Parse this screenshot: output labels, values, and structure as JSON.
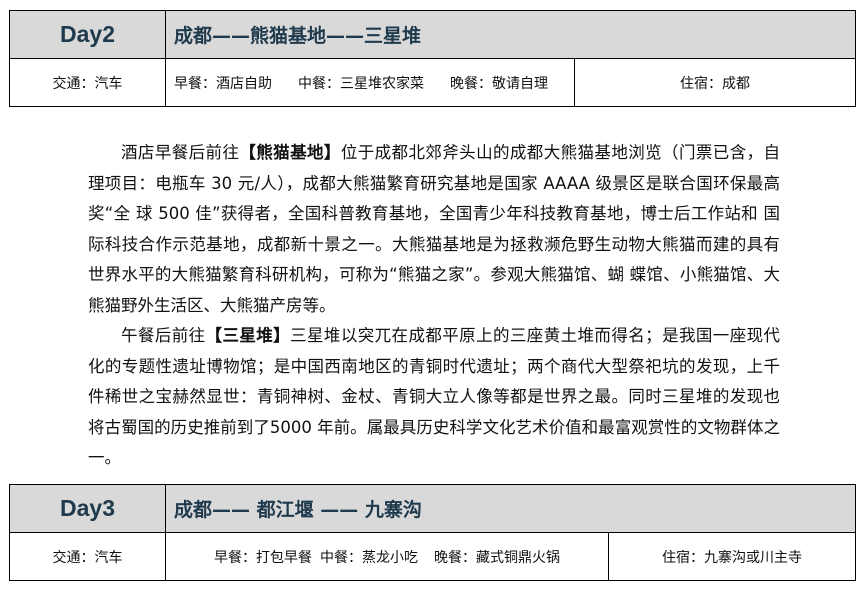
{
  "day2": {
    "day_label": "Day2",
    "route": "成都——熊猫基地——三星堆",
    "transport": "交通：汽车",
    "breakfast": "早餐：酒店自助",
    "lunch": "中餐：三星堆农家菜",
    "dinner": "晚餐：敬请自理",
    "lodging": "住宿：成都"
  },
  "paragraphs": [
    {
      "pre": "酒店早餐后前往",
      "bold": "【熊猫基地】",
      "post": "位于成都北郊斧头山的成都大熊猫基地浏览（门票已含，自理项目：电瓶车 30 元/人），成都大熊猫繁育研究基地是国家 AAAA 级景区是联合国环保最高奖“全 球 500 佳”获得者，全国科普教育基地，全国青少年科技教育基地，博士后工作站和 国际科技合作示范基地，成都新十景之一。大熊猫基地是为拯救濒危野生动物大熊猫而建的具有世界水平的大熊猫繁育科研机构，可称为“熊猫之家”。参观大熊猫馆、蝴 蝶馆、小熊猫馆、大熊猫野外生活区、大熊猫产房等。"
    },
    {
      "pre": "午餐后前往",
      "bold": "【三星堆】",
      "post": "三星堆以突兀在成都平原上的三座黄土堆而得名；是我国一座现代化的专题性遗址博物馆；是中国西南地区的青铜时代遗址；两个商代大型祭祀坑的发现，上千件稀世之宝赫然显世：青铜神树、金杖、青铜大立人像等都是世界之最。同时三星堆的发现也将古蜀国的历史推前到了5000 年前。属最具历史科学文化艺术价值和最富观赏性的文物群体之一。"
    }
  ],
  "day3": {
    "day_label": "Day3",
    "route": "成都—— 都江堰 —— 九寨沟",
    "transport": "交通：汽车",
    "breakfast": "早餐：打包早餐",
    "lunch": "中餐：蒸龙小吃",
    "dinner": "晚餐：藏式铜鼎火锅",
    "lodging": "住宿：九寨沟或川主寺"
  }
}
